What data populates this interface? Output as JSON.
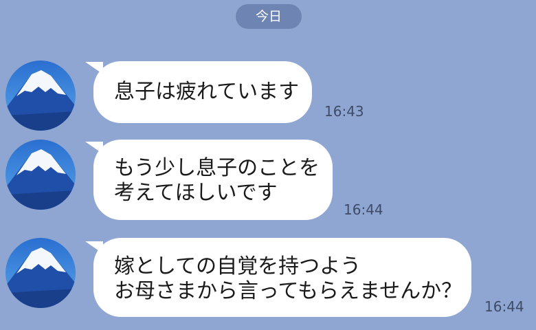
{
  "date_divider": "今日",
  "messages": [
    {
      "lines": [
        "息子は疲れています"
      ],
      "time": "16:43",
      "avatar_icon": "mount-fuji-avatar-icon"
    },
    {
      "lines": [
        "もう少し息子のことを",
        "考えてほしいです"
      ],
      "time": "16:44",
      "avatar_icon": "mount-fuji-avatar-icon"
    },
    {
      "lines": [
        "嫁としての自覚を持つよう",
        "お母さまから言ってもらえませんか？"
      ],
      "time": "16:44",
      "avatar_icon": "mount-fuji-avatar-icon"
    }
  ],
  "colors": {
    "background": "#8fa6d3",
    "date_pill": "#6e84b3",
    "bubble": "#ffffff",
    "time_text": "#3d4b66"
  }
}
